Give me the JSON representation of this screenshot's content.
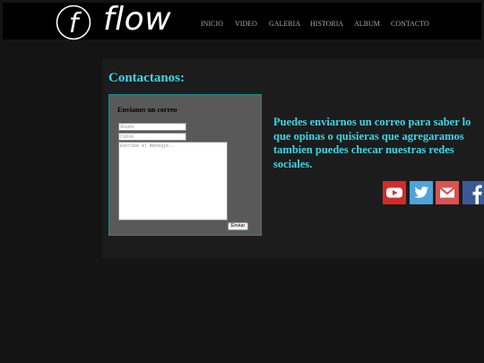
{
  "header": {
    "logo": {
      "text": "flow",
      "icon": "circle-f-logo-icon",
      "mark": "f"
    },
    "nav": [
      {
        "label": "INICIO"
      },
      {
        "label": "VIDEO"
      },
      {
        "label": "GALERIA"
      },
      {
        "label": "HISTORIA"
      },
      {
        "label": "ALBUM"
      },
      {
        "label": "CONTACTO"
      }
    ]
  },
  "main": {
    "title": "Contactanos:",
    "form": {
      "heading": "Envianos un correo",
      "subject_placeholder": "Asunto",
      "email_placeholder": "Correo",
      "message_placeholder": "Escribe el mensaje..",
      "send_label": "Enviar"
    },
    "message": "Puedes enviarnos un correo para saber lo que opinas o quisieras que agregaramos tambien puedes checar nuestras redes sociales.",
    "social": [
      {
        "name": "youtube-icon",
        "color": "#d32a2a"
      },
      {
        "name": "twitter-icon",
        "color": "#4ea3d8"
      },
      {
        "name": "mail-icon",
        "color": "#d9534f"
      },
      {
        "name": "facebook-icon",
        "color": "#3b5998"
      }
    ]
  },
  "colors": {
    "accent": "#3ad6e6",
    "background": "#141414",
    "header": "#000000",
    "panel": "#1c1c1c",
    "form_panel": "#595959",
    "form_border": "#1b8c8c"
  }
}
